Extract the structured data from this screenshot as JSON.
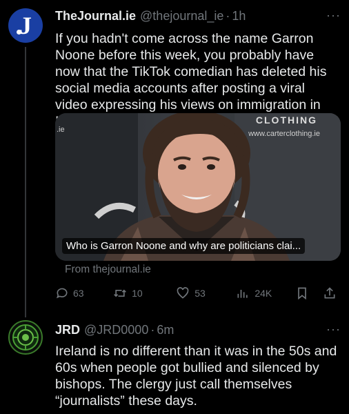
{
  "tweet1": {
    "author_name": "TheJournal.ie",
    "author_handle": "@thejournal_ie",
    "separator": "·",
    "time": "1h",
    "text": "If you hadn't come across the name Garron Noone before this week, you probably have now that the TikTok comedian has deleted his social media accounts after posting a viral video expressing his views on immigration in Ireland.",
    "card": {
      "title": "Who is Garron Noone and why are politicians clai...",
      "brand_text": "CLOTHING",
      "brand_url": "www.carterclothing.ie",
      "left_url": ".ie",
      "source": "From thejournal.ie"
    },
    "actions": {
      "replies": "63",
      "retweets": "10",
      "likes": "53",
      "views": "24K"
    }
  },
  "tweet2": {
    "author_name": "JRD",
    "author_handle": "@JRD0000",
    "separator": "·",
    "time": "6m",
    "text": "Ireland is no different than it was in the 50s and 60s when people got bullied and silenced by bishops. The clergy just call themselves “journalists” these days."
  },
  "more_glyph": "···",
  "colors": {
    "background": "#000000",
    "text": "#e7e9ea",
    "muted": "#71767b",
    "thejournal_brand": "#1a3fa3",
    "jrd_avatar_ring": "#3a7a2a"
  },
  "icons": [
    "reply-icon",
    "retweet-icon",
    "like-icon",
    "views-icon",
    "bookmark-icon",
    "share-icon",
    "more-icon"
  ]
}
